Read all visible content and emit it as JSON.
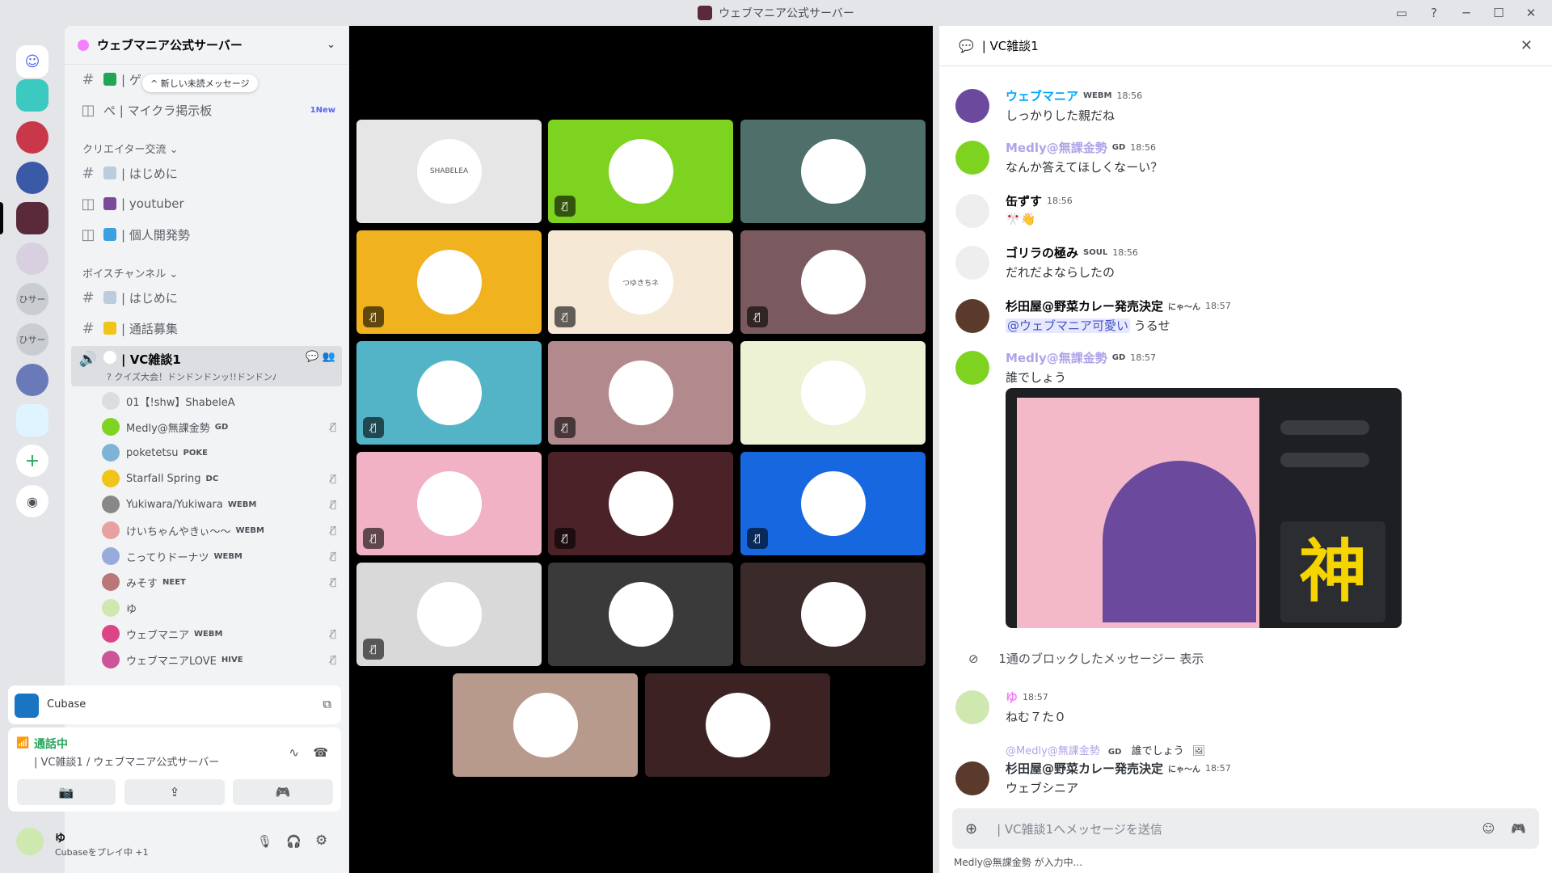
{
  "window": {
    "title": "ウェブマニア公式サーバー"
  },
  "colors": {
    "accent": "#5865f2",
    "green": "#23a559",
    "link": "#00a8fc"
  },
  "server": {
    "name": "ウェブマニア公式サーバー"
  },
  "channels": {
    "unread_pill": "^ 新しい未読メッセージ",
    "top_items": [
      {
        "label": "| ゲ",
        "icon": "hash"
      },
      {
        "label": "ぺ | マイクラ掲示板",
        "icon": "forum",
        "badge": "1New"
      }
    ],
    "cat1": "クリエイター交流 ⌄",
    "cat1_items": [
      {
        "label": "| はじめに",
        "icon": "hash"
      },
      {
        "label": "| youtuber",
        "icon": "forum"
      },
      {
        "label": "| 個人開発勢",
        "icon": "forum"
      }
    ],
    "cat2": "ボイスチャンネル ⌄",
    "cat2_items": [
      {
        "label": "| はじめに",
        "icon": "hash"
      },
      {
        "label": "| 通話募集",
        "icon": "hash"
      }
    ],
    "vc": {
      "label": "| VC雑談1",
      "status": "? クイズ大会！ドンドンドンッ!!ドンドンパフ!!"
    },
    "voice_users": [
      {
        "name": "01【!shw】ShabeleA",
        "tag": "",
        "muted": false,
        "color": "#ddd"
      },
      {
        "name": "Medly@無課金勢",
        "tag": "GD",
        "muted": true,
        "color": "#7ed321"
      },
      {
        "name": "poketetsu",
        "tag": "POKE",
        "muted": false,
        "color": "#7fb3d5"
      },
      {
        "name": "Starfall Spring",
        "tag": "DC",
        "muted": true,
        "color": "#f0c419"
      },
      {
        "name": "Yukiwara/Yukiwara",
        "tag": "WEBM",
        "muted": true,
        "color": "#888"
      },
      {
        "name": "けいちゃんやきぃ～～",
        "tag": "WEBM",
        "muted": true,
        "color": "#e8a0a0"
      },
      {
        "name": "こってりドーナツ",
        "tag": "WEBM",
        "muted": true,
        "color": "#9ad"
      },
      {
        "name": "みそす",
        "tag": "NEET",
        "muted": true,
        "color": "#b77"
      },
      {
        "name": "ゆ",
        "tag": "",
        "muted": false,
        "color": "#cfe8b0"
      },
      {
        "name": "ウェブマニア",
        "tag": "WEBM",
        "muted": true,
        "color": "#d48"
      },
      {
        "name": "ウェブマニアLOVE",
        "tag": "HIVE",
        "muted": true,
        "color": "#c59"
      }
    ]
  },
  "activity": {
    "app": "Cubase"
  },
  "voice_status": {
    "state": "通話中",
    "location": "| VC雑談1 / ウェブマニア公式サーバー"
  },
  "user_panel": {
    "name": "ゆ",
    "status": "Cubaseをプレイ中 +1"
  },
  "stage": {
    "tiles": [
      {
        "bg": "#e6e6e6",
        "label": "SHABELEA",
        "muted": false
      },
      {
        "bg": "#7ed321",
        "label": "",
        "muted": true
      },
      {
        "bg": "#4f6f6a",
        "label": "",
        "muted": false
      },
      {
        "bg": "#f0b21e",
        "label": "",
        "muted": true
      },
      {
        "bg": "#f5e9d6",
        "label": "つゆきちネ",
        "muted": true
      },
      {
        "bg": "#7a5a5e",
        "label": "",
        "muted": true
      },
      {
        "bg": "#53b4c8",
        "label": "",
        "muted": true
      },
      {
        "bg": "#b28a8e",
        "label": "",
        "muted": true
      },
      {
        "bg": "#eef2d4",
        "label": "",
        "muted": false
      },
      {
        "bg": "#f0b2c4",
        "label": "",
        "muted": true
      },
      {
        "bg": "#4a2228",
        "label": "",
        "muted": true
      },
      {
        "bg": "#1768e0",
        "label": "",
        "muted": true
      },
      {
        "bg": "#d9d9d9",
        "label": "",
        "muted": true
      },
      {
        "bg": "#3a3a3a",
        "label": "",
        "muted": false
      },
      {
        "bg": "#3a2a2a",
        "label": "",
        "muted": false
      },
      {
        "bg": "#b79a8c",
        "label": "",
        "muted": false
      },
      {
        "bg": "#3d2223",
        "label": "",
        "muted": false
      }
    ]
  },
  "chat": {
    "header": "| VC雑談1",
    "messages": [
      {
        "name": "ウェブマニア",
        "color": "#00a8fc",
        "badge": "WEBM",
        "time": "18:56",
        "text": "しっかりした親だね"
      },
      {
        "name": "Medly@無課金勢",
        "color": "#b0a3e8",
        "badge": "GD",
        "time": "18:56",
        "text": "なんか答えてほしくなーい？"
      },
      {
        "name": "缶ずす",
        "color": "#060607",
        "badge": "",
        "time": "18:56",
        "text": "🎌👋"
      },
      {
        "name": "ゴリラの極み",
        "color": "#060607",
        "badge": "SOUL",
        "time": "18:56",
        "text": "だれだよならしたの"
      },
      {
        "name": "杉田屋@野菜カレー発売決定",
        "color": "#060607",
        "badge": "にゃ～ん",
        "time": "18:57",
        "mention": "@ウェブマニア可愛い",
        "text": " うるせ"
      },
      {
        "name": "Medly@無課金勢",
        "color": "#b0a3e8",
        "badge": "GD",
        "time": "18:57",
        "text": "誰でしょう"
      }
    ],
    "sticker_kanji": "神",
    "blocked": "1通のブロックしたメッセージー 表示",
    "msg_yu": {
      "name": "ゆ",
      "time": "18:57",
      "text": "ねむ７た０"
    },
    "reply_ref": {
      "name": "@Medly@無課金勢",
      "badge": "GD",
      "text": "誰でしょう"
    },
    "last": {
      "name": "杉田屋@野菜カレー発売決定",
      "badge": "にゃ～ん",
      "time": "18:57",
      "text": "ウェブシニア"
    },
    "input_placeholder": "| VC雑談1へメッセージを送信",
    "typing": "Medly@無課金勢 が入力中..."
  }
}
